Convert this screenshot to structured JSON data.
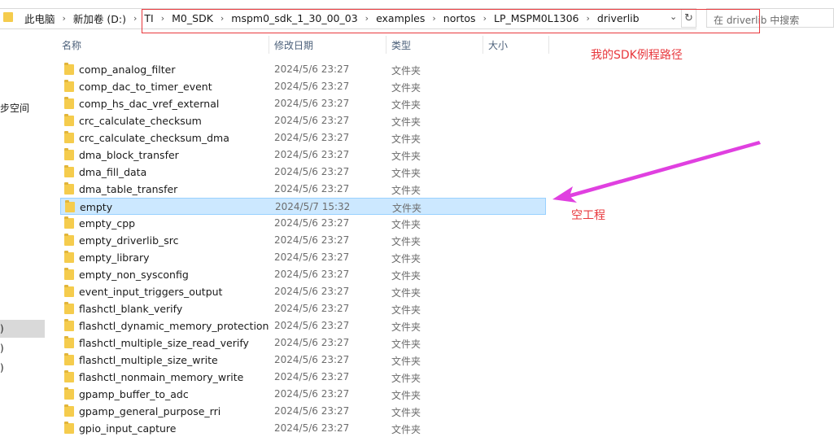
{
  "address_bar": {
    "breadcrumbs": [
      "此电脑",
      "新加卷 (D:)",
      "TI",
      "M0_SDK",
      "mspm0_sdk_1_30_00_03",
      "examples",
      "nortos",
      "LP_MSPM0L1306",
      "driverlib"
    ],
    "search_placeholder": "在 driverlib 中搜索",
    "refresh_glyph": "↻",
    "dropdown_glyph": "⌄"
  },
  "columns": {
    "name": "名称",
    "date": "修改日期",
    "type": "类型",
    "size": "大小"
  },
  "sidebar": {
    "fragments": [
      "步空间",
      ")",
      ")",
      ")"
    ]
  },
  "files": [
    {
      "name": "comp_analog_filter",
      "date": "2024/5/6 23:27",
      "type": "文件夹"
    },
    {
      "name": "comp_dac_to_timer_event",
      "date": "2024/5/6 23:27",
      "type": "文件夹"
    },
    {
      "name": "comp_hs_dac_vref_external",
      "date": "2024/5/6 23:27",
      "type": "文件夹"
    },
    {
      "name": "crc_calculate_checksum",
      "date": "2024/5/6 23:27",
      "type": "文件夹"
    },
    {
      "name": "crc_calculate_checksum_dma",
      "date": "2024/5/6 23:27",
      "type": "文件夹"
    },
    {
      "name": "dma_block_transfer",
      "date": "2024/5/6 23:27",
      "type": "文件夹"
    },
    {
      "name": "dma_fill_data",
      "date": "2024/5/6 23:27",
      "type": "文件夹"
    },
    {
      "name": "dma_table_transfer",
      "date": "2024/5/6 23:27",
      "type": "文件夹"
    },
    {
      "name": "empty",
      "date": "2024/5/7 15:32",
      "type": "文件夹",
      "selected": true
    },
    {
      "name": "empty_cpp",
      "date": "2024/5/6 23:27",
      "type": "文件夹"
    },
    {
      "name": "empty_driverlib_src",
      "date": "2024/5/6 23:27",
      "type": "文件夹"
    },
    {
      "name": "empty_library",
      "date": "2024/5/6 23:27",
      "type": "文件夹"
    },
    {
      "name": "empty_non_sysconfig",
      "date": "2024/5/6 23:27",
      "type": "文件夹"
    },
    {
      "name": "event_input_triggers_output",
      "date": "2024/5/6 23:27",
      "type": "文件夹"
    },
    {
      "name": "flashctl_blank_verify",
      "date": "2024/5/6 23:27",
      "type": "文件夹"
    },
    {
      "name": "flashctl_dynamic_memory_protection",
      "date": "2024/5/6 23:27",
      "type": "文件夹"
    },
    {
      "name": "flashctl_multiple_size_read_verify",
      "date": "2024/5/6 23:27",
      "type": "文件夹"
    },
    {
      "name": "flashctl_multiple_size_write",
      "date": "2024/5/6 23:27",
      "type": "文件夹"
    },
    {
      "name": "flashctl_nonmain_memory_write",
      "date": "2024/5/6 23:27",
      "type": "文件夹"
    },
    {
      "name": "gpamp_buffer_to_adc",
      "date": "2024/5/6 23:27",
      "type": "文件夹"
    },
    {
      "name": "gpamp_general_purpose_rri",
      "date": "2024/5/6 23:27",
      "type": "文件夹"
    },
    {
      "name": "gpio_input_capture",
      "date": "2024/5/6 23:27",
      "type": "文件夹"
    }
  ],
  "annotations": {
    "sdk_path_label": "我的SDK例程路径",
    "empty_project_label": "空工程",
    "highlight_color": "#e8383d",
    "arrow_color": "#e040e0"
  },
  "colors": {
    "selection_bg": "#cce8ff",
    "selection_border": "#99d1ff",
    "folder": "#f5cc4d"
  }
}
